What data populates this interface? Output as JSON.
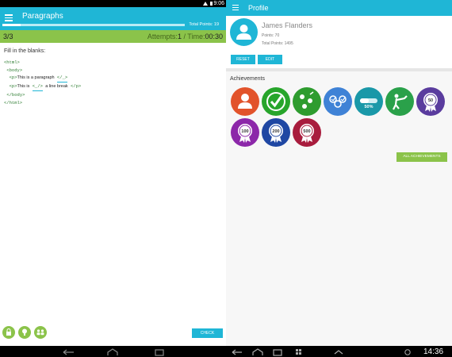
{
  "left": {
    "status_bar": {
      "time": "9:06"
    },
    "app_bar": {
      "title": "Paragraphs",
      "total_points": "Total Points: 19",
      "progress_fraction": 0.1
    },
    "quiz_bar": {
      "count": "3/3",
      "attempts_label": "Attempts:",
      "attempts_value": "1",
      "separator": " / ",
      "time_label": "Time:",
      "time_value": "00:30"
    },
    "instructions": "Fill in the blanks:",
    "code": {
      "l1": "<html>",
      "l2": "<body>",
      "l3_open": "<p>",
      "l3_text": "This is a paragraph",
      "l3_blank": "</_>",
      "l4_open": "<p>",
      "l4_text": "This is",
      "l4_blank": "<_/>",
      "l4_text2": "a line break",
      "l4_close": "</p>",
      "l5": "</body>",
      "l6": "</html>"
    },
    "bottom_buttons": {
      "icons": [
        "lock-icon",
        "lightbulb-icon",
        "users-icon"
      ],
      "check_label": "CHECK"
    },
    "colors": {
      "primary": "#1fb6d6",
      "accent": "#8bc34a"
    }
  },
  "right": {
    "app_bar": {
      "title": "Profile"
    },
    "profile": {
      "name": "James Flanders",
      "points": "Points: 70",
      "total_points": "Total Points: 1495",
      "reset_label": "RESET",
      "edit_label": "EDIT"
    },
    "achievements": {
      "heading": "Achievements",
      "badges": [
        {
          "icon": "person-icon",
          "color": "#e2532b"
        },
        {
          "icon": "checkmark-icon",
          "color": "#27a52b"
        },
        {
          "icon": "users-icon",
          "color": "#2e9c2f"
        },
        {
          "icon": "triple-check-icon",
          "color": "#3f82d6"
        },
        {
          "icon": "progress-icon",
          "color": "#1a98a8",
          "label": "50%"
        },
        {
          "icon": "arm-wrestle-icon",
          "color": "#2aa14a"
        },
        {
          "icon": "ribbon-50-icon",
          "color": "#5a3c9e",
          "label": "50"
        },
        {
          "icon": "ribbon-100-icon",
          "color": "#8c27a9",
          "label": "100"
        },
        {
          "icon": "ribbon-200-icon",
          "color": "#1f47a3",
          "label": "200"
        },
        {
          "icon": "ribbon-500-icon",
          "color": "#a81c3d",
          "label": "500"
        }
      ],
      "all_label": "ALL ACHIEVEMENTS"
    },
    "nav_bar": {
      "time": "14:36"
    }
  }
}
